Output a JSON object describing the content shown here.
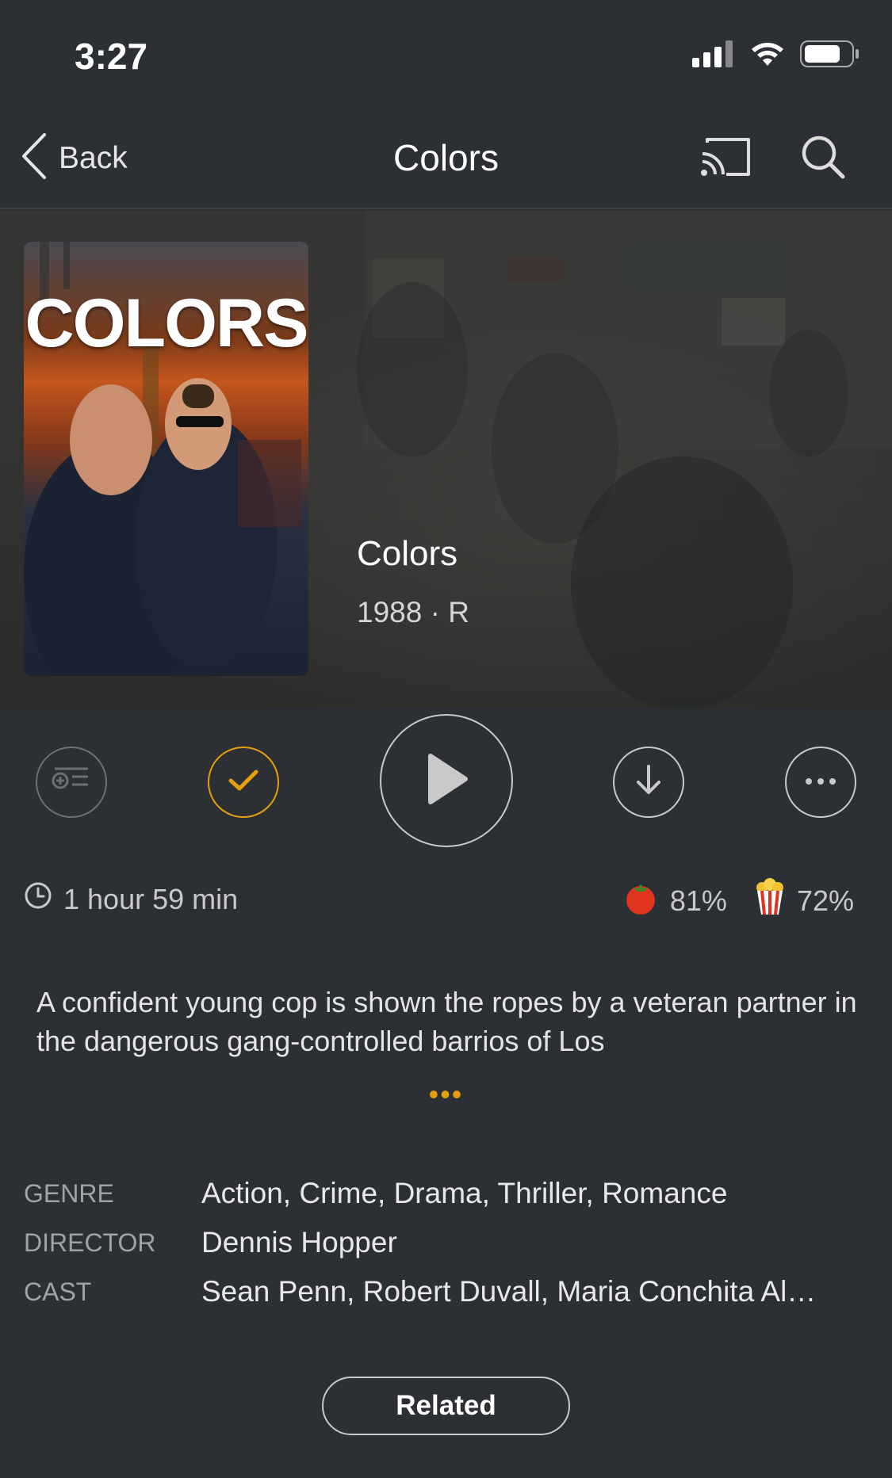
{
  "status_bar": {
    "time": "3:27"
  },
  "nav": {
    "back_label": "Back",
    "title": "Colors"
  },
  "hero": {
    "poster_text": "COLORS",
    "title": "Colors",
    "meta": "1988 · R"
  },
  "info": {
    "runtime": "1 hour 59 min",
    "critic_rating": "81%",
    "audience_rating": "72%"
  },
  "description": {
    "text": "A confident young cop is shown the ropes by a veteran partner in the dangerous gang-controlled barrios of Los",
    "more": "•••"
  },
  "details": [
    {
      "key": "GENRE",
      "value": "Action, Crime, Drama, Thriller, Romance"
    },
    {
      "key": "DIRECTOR",
      "value": "Dennis Hopper"
    },
    {
      "key": "CAST",
      "value": "Sean Penn, Robert Duvall, Maria Conchita Al…"
    }
  ],
  "related_label": "Related",
  "colors": {
    "background": "#2c2f34",
    "accent": "#e5a00d"
  }
}
